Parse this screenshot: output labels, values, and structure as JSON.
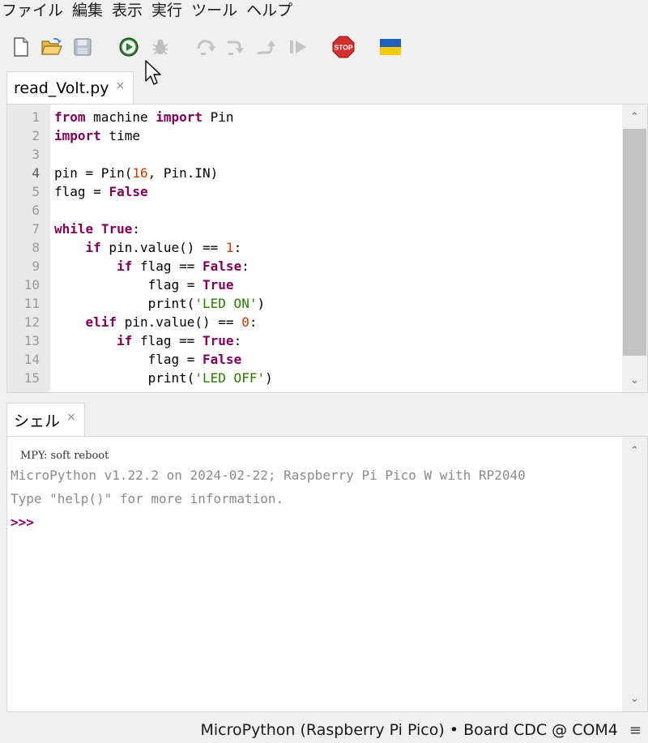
{
  "menu": [
    "ファイル",
    "編集",
    "表示",
    "実行",
    "ツール",
    "ヘルプ"
  ],
  "toolbar": {
    "buttons": [
      "new-file",
      "open-file",
      "save-file",
      "run",
      "debug",
      "step-over",
      "step-into",
      "step-out",
      "resume",
      "stop",
      "ukraine-flag"
    ],
    "stop_label": "STOP",
    "colors": {
      "run": "#2e7d32",
      "stop": "#d32f2f",
      "flag_blue": "#1f5fbf",
      "flag_yellow": "#f5cc00"
    }
  },
  "editor": {
    "tab_title": "read_Volt.py",
    "tab_close": "×",
    "active_line": 4,
    "lines": [
      {
        "num": "1"
      },
      {
        "num": "2"
      },
      {
        "num": "3"
      },
      {
        "num": "4"
      },
      {
        "num": "5"
      },
      {
        "num": "6"
      },
      {
        "num": "7"
      },
      {
        "num": "8"
      },
      {
        "num": "9"
      },
      {
        "num": "10"
      },
      {
        "num": "11"
      },
      {
        "num": "12"
      },
      {
        "num": "13"
      },
      {
        "num": "14"
      },
      {
        "num": "15"
      }
    ],
    "code": [
      [
        "kw:from",
        " machine ",
        "kw:import",
        " Pin"
      ],
      [
        "kw:import",
        " time"
      ],
      [],
      [
        "pin = Pin(",
        "num:16",
        ", Pin.IN)"
      ],
      [
        "flag = ",
        "kw:False"
      ],
      [],
      [
        "kw:while",
        " ",
        "kw:True",
        ":"
      ],
      [
        "    ",
        "kw:if",
        " pin.value() == ",
        "num:1",
        ":"
      ],
      [
        "        ",
        "kw:if",
        " flag == ",
        "kw:False",
        ":"
      ],
      [
        "            flag = ",
        "kw:True"
      ],
      [
        "            print(",
        "str:'LED ON'",
        ")"
      ],
      [
        "    ",
        "kw:elif",
        " pin.value() == ",
        "num:0",
        ":"
      ],
      [
        "        ",
        "kw:if",
        " flag == ",
        "kw:True",
        ":"
      ],
      [
        "            flag = ",
        "kw:False"
      ],
      [
        "            print(",
        "str:'LED OFF'",
        ")"
      ]
    ],
    "scroll_up": "⌃",
    "scroll_down": "⌄"
  },
  "shell": {
    "tab_title": "シェル",
    "tab_close": "×",
    "reboot": "MPY: soft reboot",
    "banner": "MicroPython v1.22.2 on 2024-02-22; Raspberry Pi Pico W with RP2040",
    "help": "Type \"help()\" for more information.",
    "prompt": ">>>"
  },
  "status": {
    "text": "MicroPython (Raspberry Pi Pico)  •  Board CDC @ COM4",
    "menu_icon": "≡"
  }
}
